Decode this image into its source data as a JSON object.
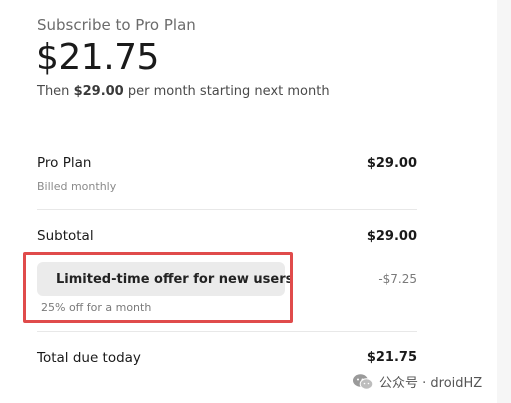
{
  "header": {
    "title": "Subscribe to Pro Plan",
    "price": "$21.75",
    "then_prefix": "Then ",
    "then_amount": "$29.00",
    "then_suffix": " per month starting next month"
  },
  "line_items": {
    "plan": {
      "label": "Pro Plan",
      "sublabel": "Billed monthly",
      "amount": "$29.00"
    },
    "subtotal": {
      "label": "Subtotal",
      "amount": "$29.00"
    }
  },
  "promo": {
    "icon": "tag-icon",
    "label": "Limited-time offer for new users",
    "amount": "-$7.25",
    "sublabel": "25% off for a month",
    "highlight_color": "#e04b4b"
  },
  "total": {
    "label": "Total due today",
    "amount": "$21.75"
  },
  "watermark": {
    "icon": "wechat-icon",
    "text": "公众号 · droidHZ"
  }
}
